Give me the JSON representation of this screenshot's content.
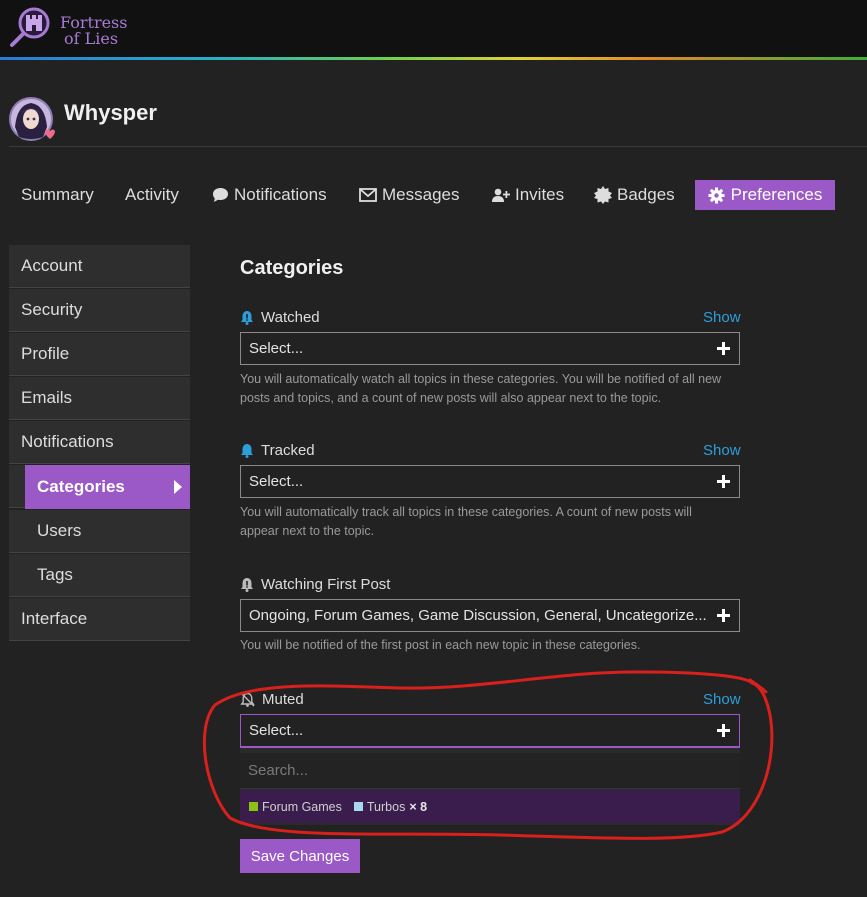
{
  "site": {
    "logo_line1": "Fortress",
    "logo_line2": "of Lies",
    "accent": "#9a59c6"
  },
  "user": {
    "name": "Whysper"
  },
  "nav": {
    "summary": "Summary",
    "activity": "Activity",
    "notifications": "Notifications",
    "messages": "Messages",
    "invites": "Invites",
    "badges": "Badges",
    "preferences": "Preferences"
  },
  "sidebar": {
    "items": [
      "Account",
      "Security",
      "Profile",
      "Emails",
      "Notifications",
      "Categories",
      "Users",
      "Tags",
      "Interface"
    ],
    "selected": "Categories"
  },
  "main": {
    "title": "Categories",
    "show_label": "Show",
    "watched": {
      "label": "Watched",
      "value": "Select...",
      "help": "You will automatically watch all topics in these categories. You will be notified of all new posts and topics, and a count of new posts will also appear next to the topic."
    },
    "tracked": {
      "label": "Tracked",
      "value": "Select...",
      "help": "You will automatically track all topics in these categories. A count of new posts will appear next to the topic."
    },
    "watching_first_post": {
      "label": "Watching First Post",
      "value": "Ongoing, Forum Games, Game Discussion, General, Uncategorize...",
      "help": "You will be notified of the first post in each new topic in these categories."
    },
    "muted": {
      "label": "Muted",
      "value": "Select...",
      "search_placeholder": "Search...",
      "results": [
        {
          "name": "Forum Games",
          "color": "#8dc214"
        },
        {
          "name": "Turbos",
          "color": "#a6d8f2",
          "count": "× 8"
        }
      ]
    },
    "save_label": "Save Changes"
  }
}
